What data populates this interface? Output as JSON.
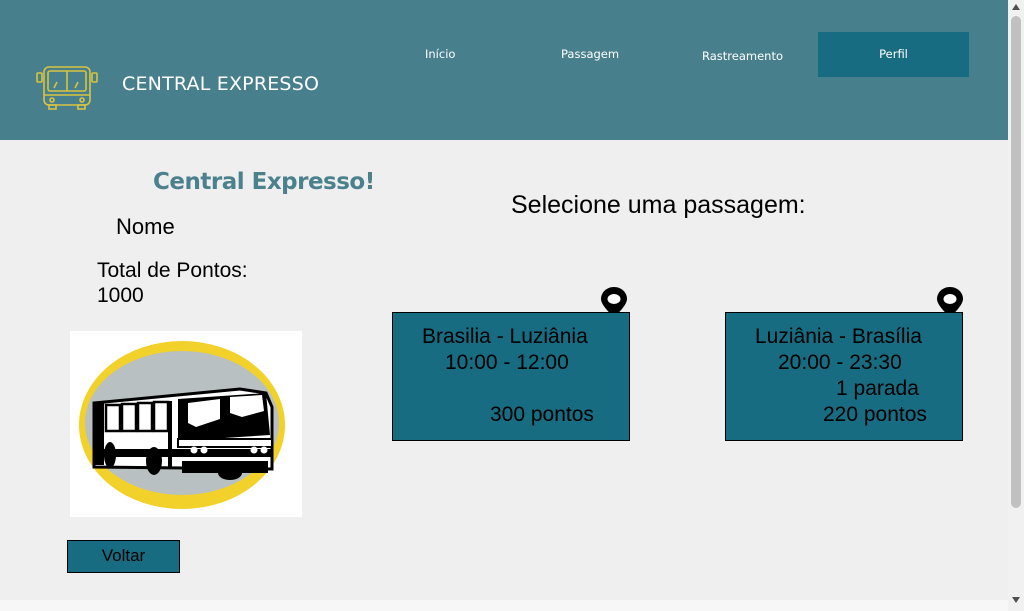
{
  "header": {
    "brand": "CENTRAL EXPRESSO",
    "logo_icon": "bus-icon",
    "nav": {
      "inicio": "Início",
      "passagem": "Passagem",
      "rastreamento": "Rastreamento",
      "perfil": "Perfil"
    }
  },
  "profile": {
    "welcome": "Central Expresso!",
    "name_label": "Nome",
    "points_label": "Total de Pontos:",
    "points_value": "1000",
    "image_icon": "bus-illustration",
    "back_button": "Voltar"
  },
  "tickets": {
    "title": "Selecione uma passagem:",
    "pin_icon": "location-pin-icon",
    "items": [
      {
        "route": "Brasilia - Luziânia",
        "time": "10:00 - 12:00",
        "stops": "",
        "points": "300 pontos"
      },
      {
        "route": "Luziânia - Brasília",
        "time": "20:00 - 23:30",
        "stops": "1 parada",
        "points": "220 pontos"
      }
    ]
  },
  "colors": {
    "header_bg": "#477f8d",
    "accent": "#176c81",
    "welcome_text": "#4b818d",
    "logo_yellow": "#d9c440",
    "page_bg": "#efefef"
  }
}
